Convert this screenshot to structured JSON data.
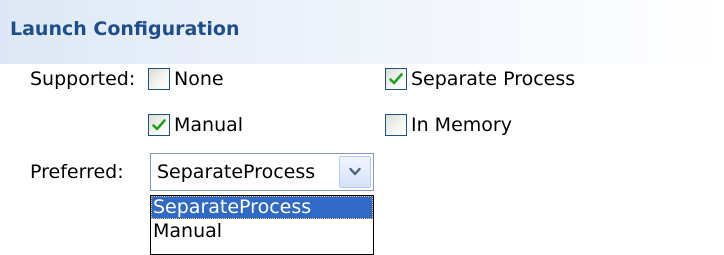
{
  "section": {
    "title": "Launch Configuration"
  },
  "supported": {
    "label": "Supported:",
    "options": [
      {
        "label": "None",
        "checked": false
      },
      {
        "label": "Separate Process",
        "checked": true
      },
      {
        "label": "Manual",
        "checked": true
      },
      {
        "label": "In Memory",
        "checked": false
      }
    ]
  },
  "preferred": {
    "label": "Preferred:",
    "value": "SeparateProcess",
    "options": [
      "SeparateProcess",
      "Manual"
    ],
    "highlighted": "SeparateProcess"
  },
  "colors": {
    "title": "#1f4e8c",
    "checkmark": "#21a121",
    "selection": "#316ac5"
  },
  "icons": {
    "checkmark": "checkmark-icon",
    "dropdown_arrow": "chevron-down-icon"
  }
}
